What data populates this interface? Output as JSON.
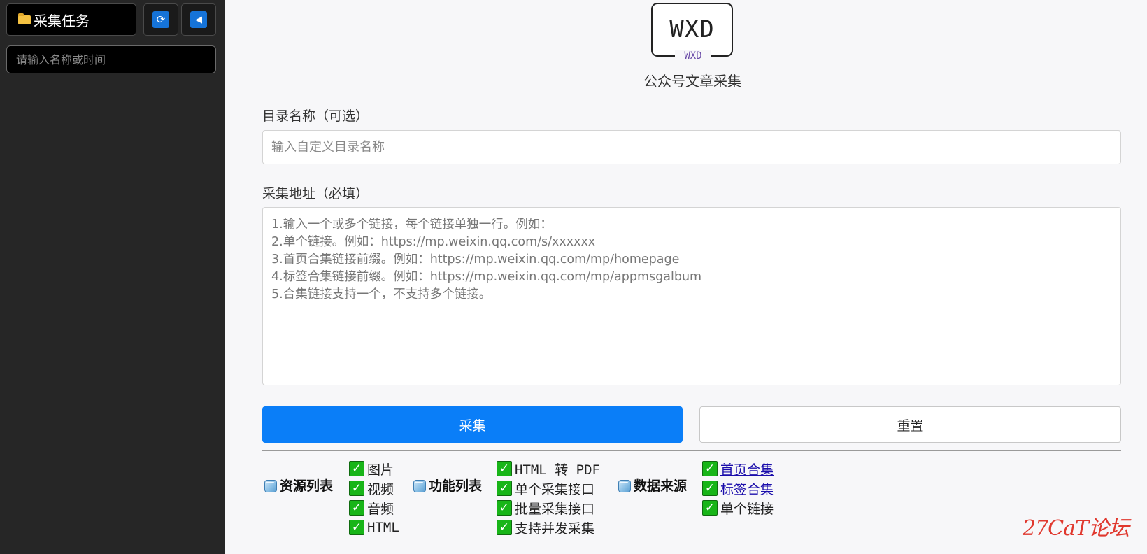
{
  "sidebar": {
    "task_button_label": "采集任务",
    "folder_icon": "folder-icon",
    "refresh_icon": "refresh-icon",
    "refresh_glyph": "⟳",
    "collapse_icon": "triangle-left-icon",
    "collapse_glyph": "◀",
    "search_placeholder": "请输入名称或时间"
  },
  "header": {
    "logo_main": "WXD",
    "logo_sub": "WXD",
    "title": "公众号文章采集"
  },
  "form": {
    "dir_label": "目录名称（可选）",
    "dir_placeholder": "输入自定义目录名称",
    "url_label": "采集地址（必填）",
    "url_placeholder": "1.输入一个或多个链接，每个链接单独一行。例如：\n2.单个链接。例如：https://mp.weixin.qq.com/s/xxxxxx\n3.首页合集链接前缀。例如：https://mp.weixin.qq.com/mp/homepage\n4.标签合集链接前缀。例如：https://mp.weixin.qq.com/mp/appmsgalbum\n5.合集链接支持一个，不支持多个链接。",
    "collect_button": "采集",
    "reset_button": "重置"
  },
  "features": {
    "resources": {
      "title": "资源列表",
      "items": [
        "图片",
        "视频",
        "音频",
        "HTML"
      ]
    },
    "functions": {
      "title": "功能列表",
      "items": [
        "HTML 转 PDF",
        "单个采集接口",
        "批量采集接口",
        "支持并发采集"
      ]
    },
    "sources": {
      "title": "数据来源",
      "items": [
        "首页合集",
        "标签合集",
        "单个链接"
      ]
    },
    "check_glyph": "✓"
  },
  "watermark": "27CaT论坛",
  "colors": {
    "sidebar_bg": "#262626",
    "primary_button": "#0a7ef8",
    "check_green": "#18b518",
    "link_blue": "#1a0dab",
    "watermark_red": "#e0382e"
  }
}
